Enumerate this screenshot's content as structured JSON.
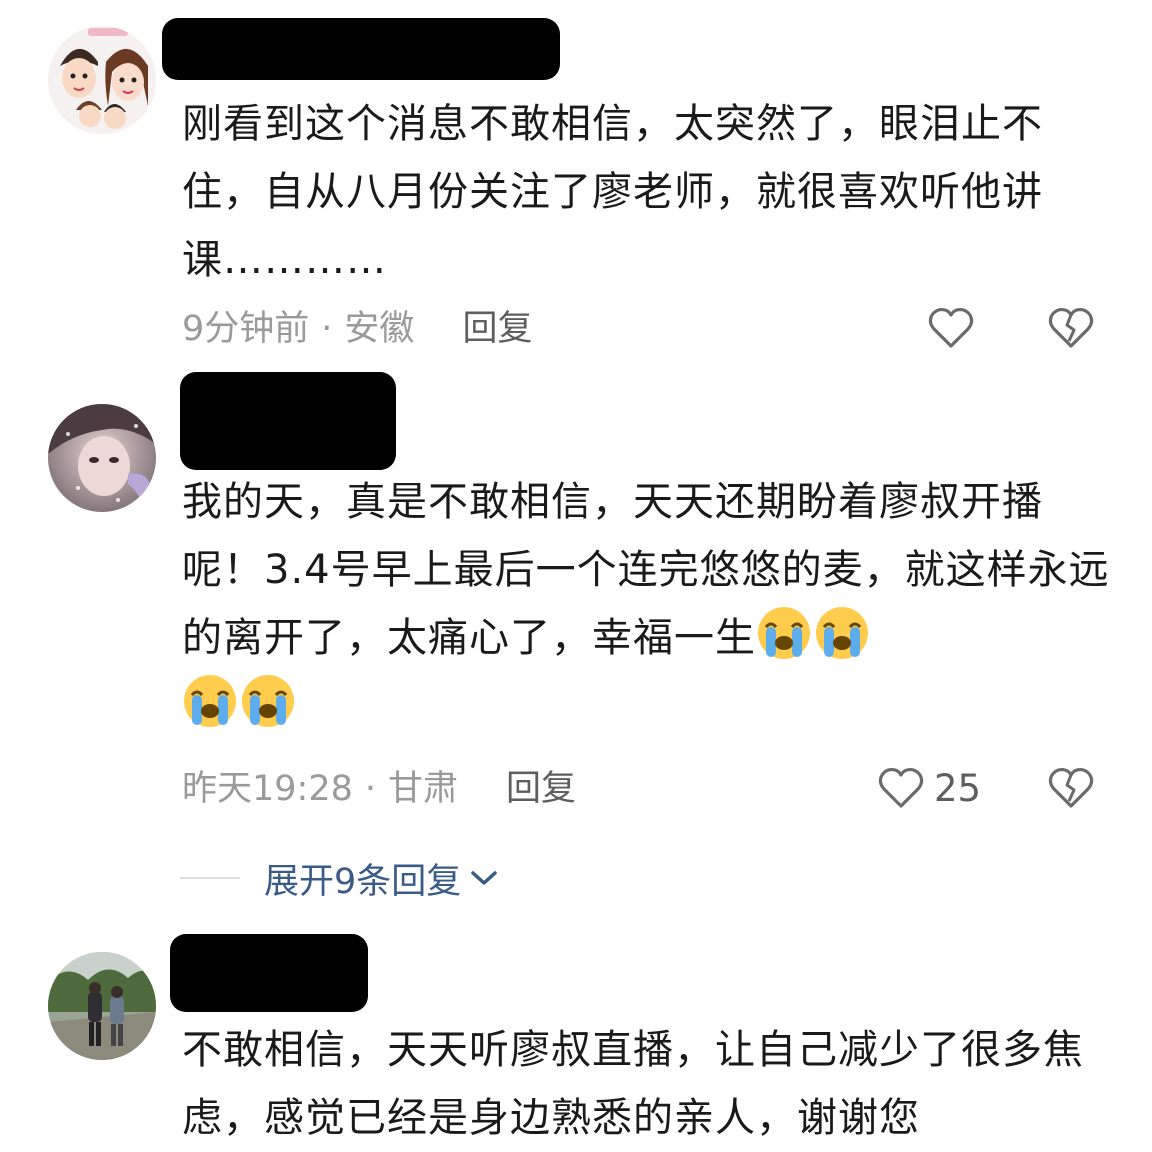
{
  "comments": [
    {
      "text": "刚看到这个消息不敢相信，太突然了，眼泪止不住，自从八月份关注了廖老师，就很喜欢听他讲课…………",
      "time": "9分钟前",
      "location": "安徽",
      "dot": "·",
      "reply": "回复",
      "likes": ""
    },
    {
      "text": "我的天，真是不敢相信，天天还期盼着廖叔开播呢！3.4号早上最后一个连完悠悠的麦，就这样永远的离开了，太痛心了，幸福一生",
      "emojis": [
        "loudly-crying-face",
        "loudly-crying-face",
        "loudly-crying-face",
        "loudly-crying-face"
      ],
      "time": "昨天19:28",
      "location": "甘肃",
      "dot": "·",
      "reply": "回复",
      "likes": "25"
    },
    {
      "text": "不敢相信，天天听廖叔直播，让自己减少了很多焦虑，感觉已经是身边熟悉的亲人，谢谢您"
    }
  ],
  "expand_replies": "展开9条回复",
  "colors": {
    "text": "#1a1a1a",
    "meta": "#9a9a9a",
    "action": "#5e5e5e",
    "link": "#3b5b87",
    "redaction": "#000000"
  },
  "icons": [
    "heart-icon",
    "broken-heart-icon",
    "chevron-down-icon",
    "loudly-crying-face-emoji"
  ]
}
